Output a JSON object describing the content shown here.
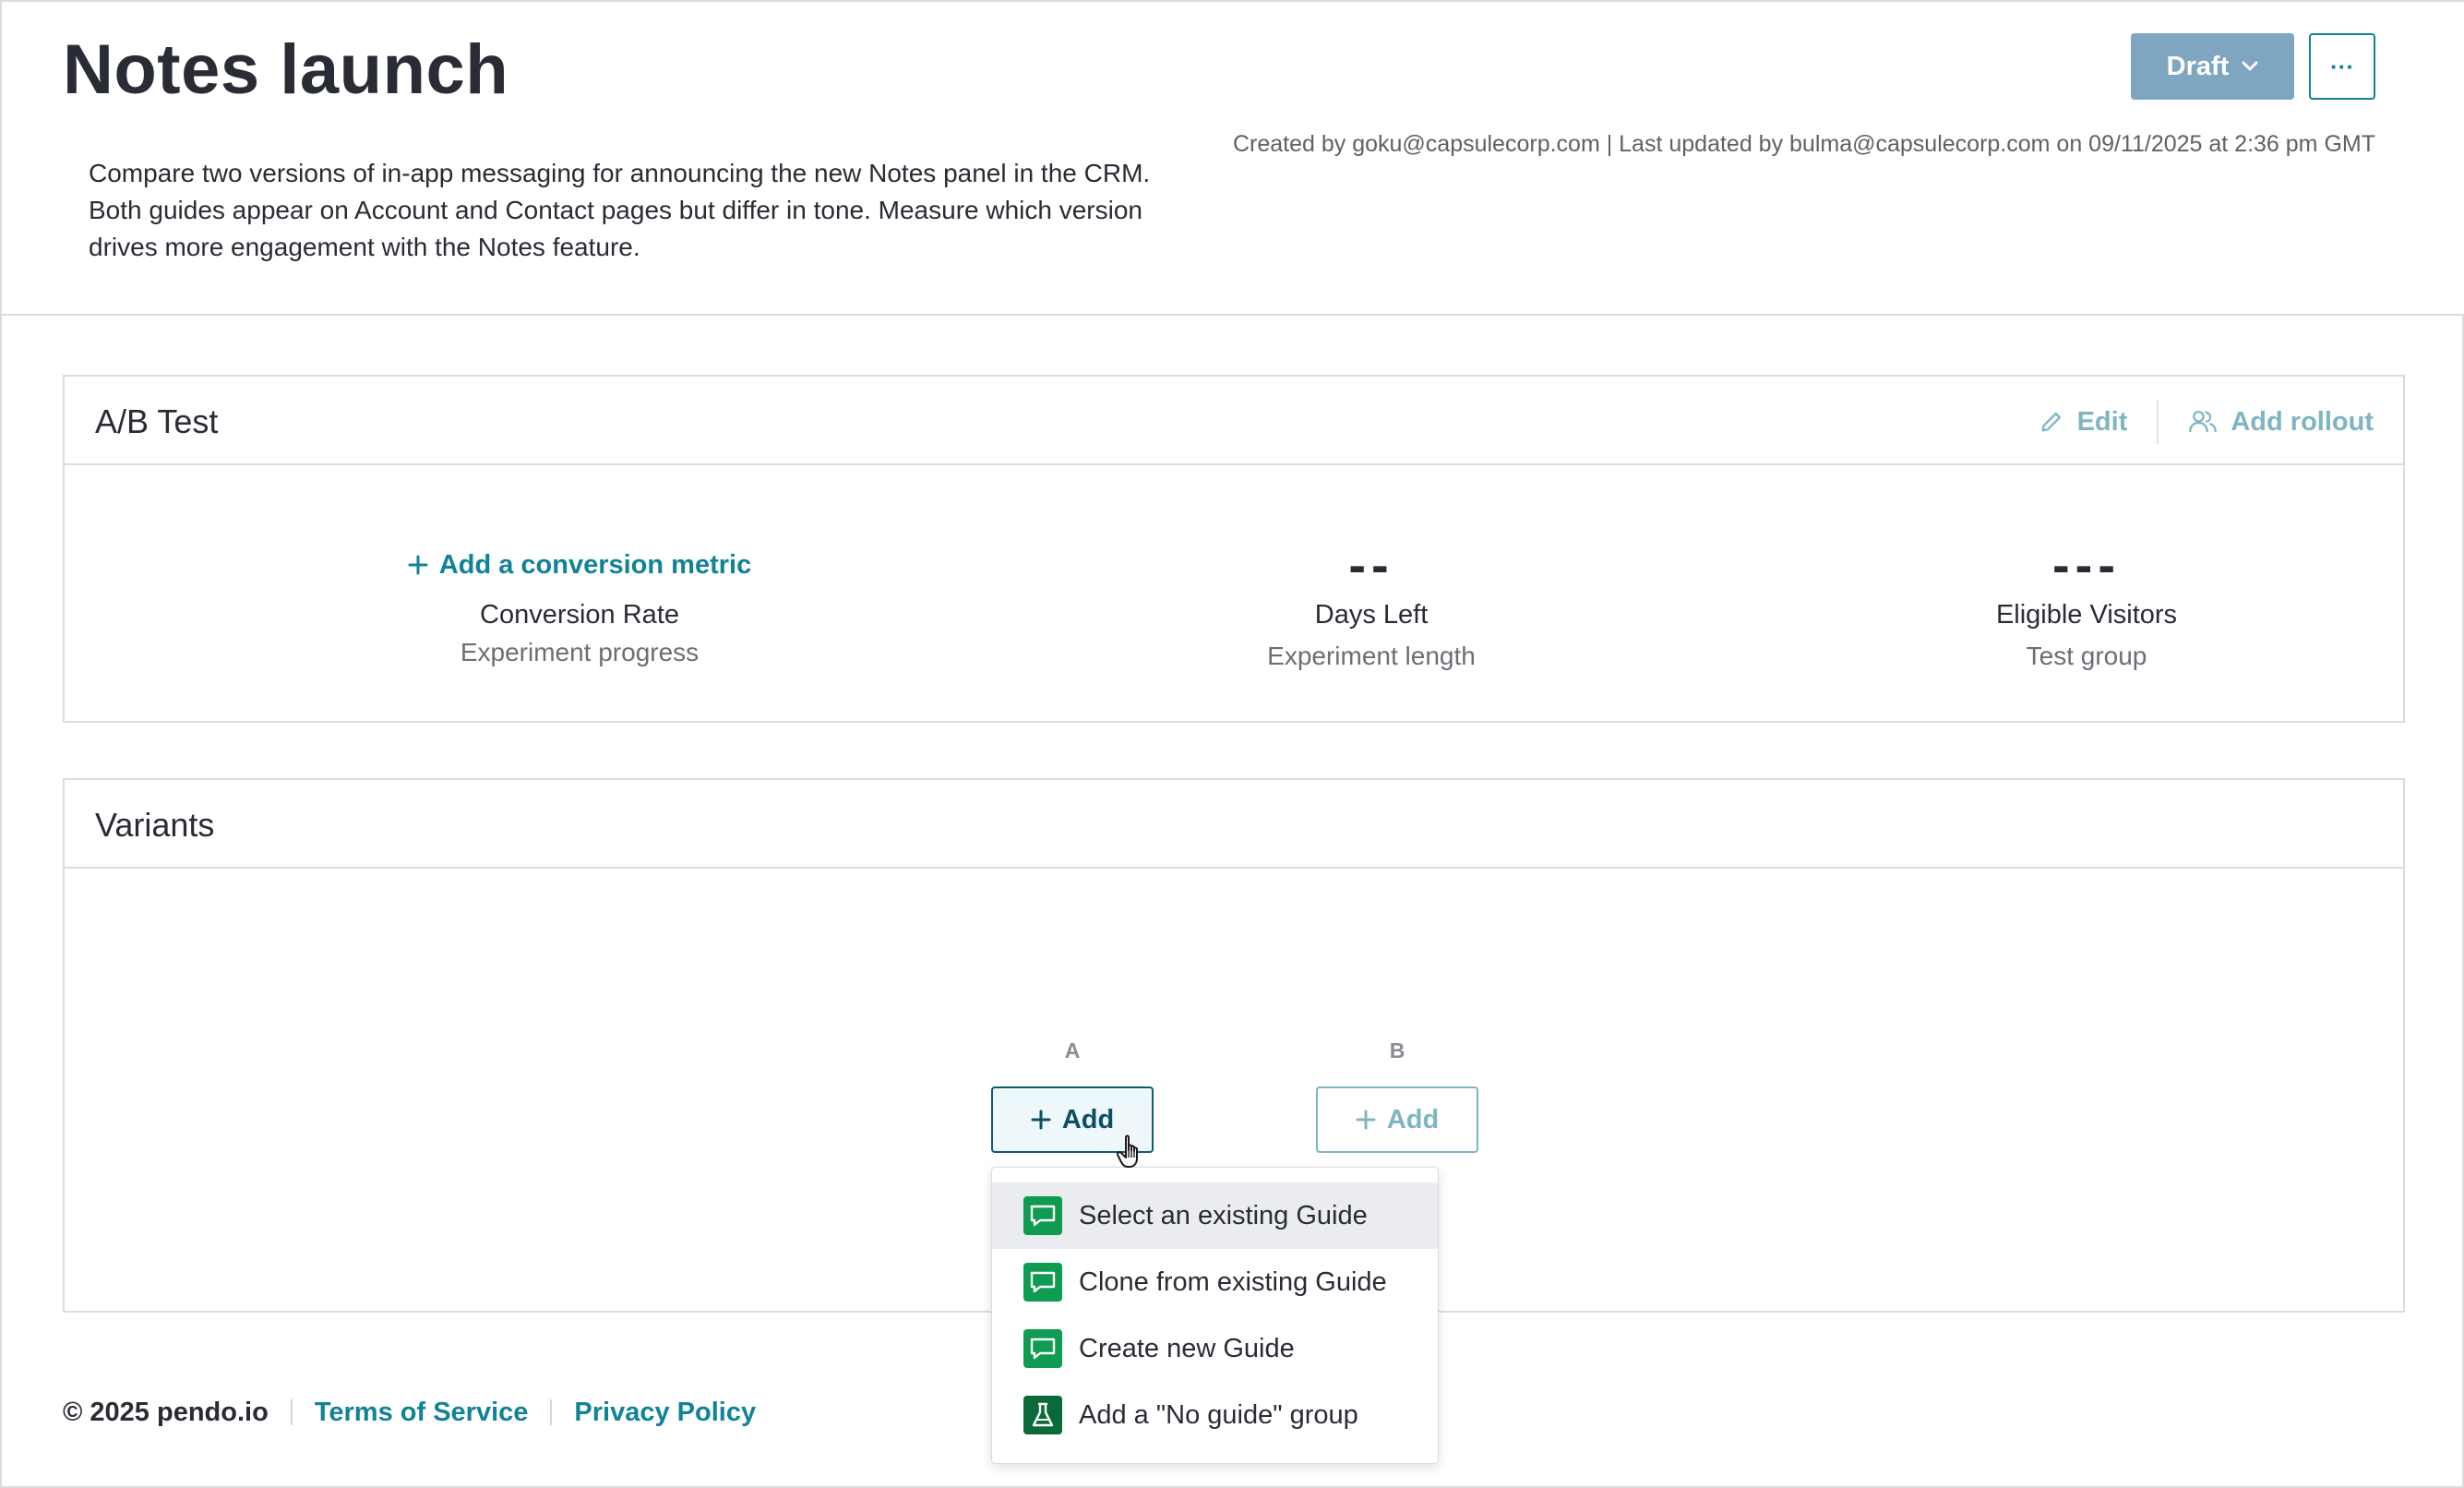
{
  "header": {
    "title": "Notes launch",
    "description": "Compare two versions of in-app messaging for announcing the new Notes panel in the CRM. Both guides appear on Account and Contact pages but differ in tone. Measure which version drives more engagement with the Notes feature.",
    "meta": "Created by goku@capsulecorp.com | Last updated by bulma@capsulecorp.com on 09/11/2025 at 2:36 pm GMT",
    "status_label": "Draft",
    "more_label": "···"
  },
  "ab_test": {
    "title": "A/B Test",
    "edit_label": "Edit",
    "add_rollout_label": "Add rollout",
    "metrics": [
      {
        "value": "",
        "link": "Add a conversion metric",
        "label": "Conversion Rate",
        "sub": "Experiment progress"
      },
      {
        "value": "--",
        "label": "Days Left",
        "sub": "Experiment length"
      },
      {
        "value": "---",
        "label": "Eligible Visitors",
        "sub": "Test group"
      }
    ]
  },
  "variants": {
    "title": "Variants",
    "items": [
      {
        "letter": "A",
        "add_label": "Add"
      },
      {
        "letter": "B",
        "add_label": "Add"
      }
    ],
    "menu": [
      {
        "label": "Select an existing Guide",
        "icon": "guide-icon"
      },
      {
        "label": "Clone from existing Guide",
        "icon": "guide-icon"
      },
      {
        "label": "Create new Guide",
        "icon": "guide-icon"
      },
      {
        "label": "Add a \"No guide\" group",
        "icon": "flask-icon"
      }
    ]
  },
  "footer": {
    "copyright": "© 2025 pendo.io",
    "terms": "Terms of Service",
    "privacy": "Privacy Policy"
  },
  "colors": {
    "accent": "#128297",
    "draft": "#7ea6c1",
    "guide_icon": "#0e9b52"
  }
}
